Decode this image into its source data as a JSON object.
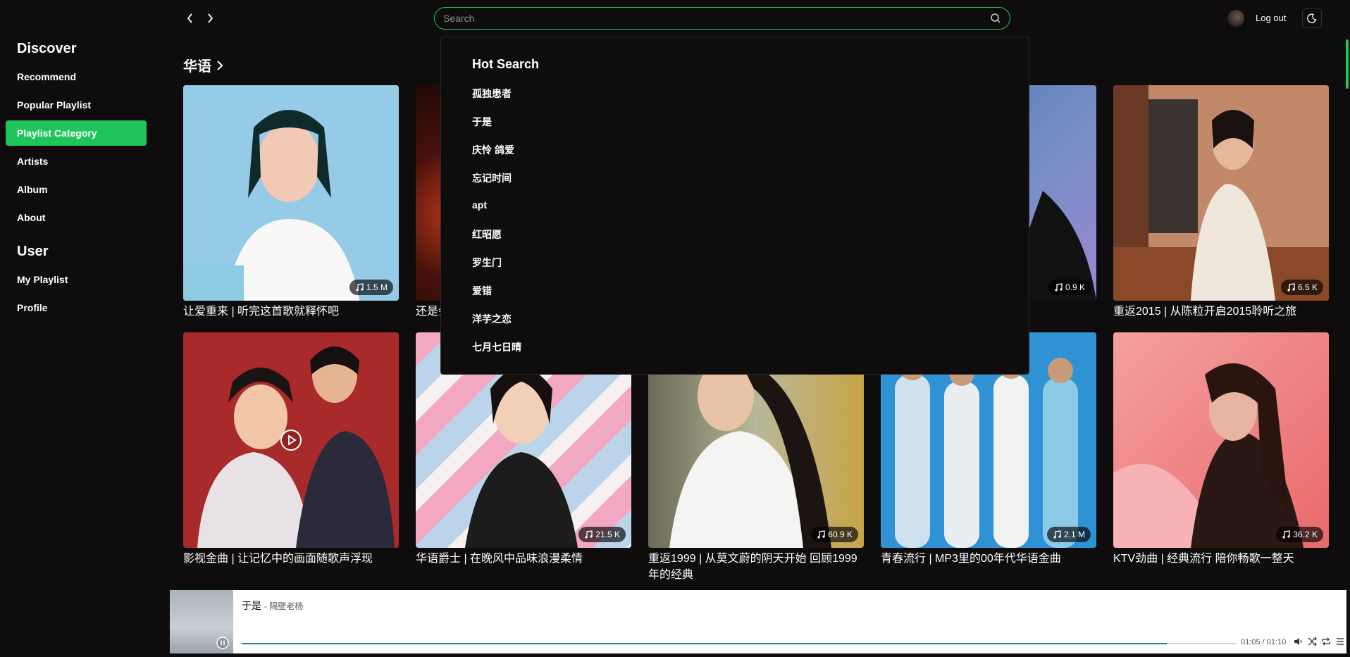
{
  "sidebar": {
    "discover_title": "Discover",
    "discover_items": [
      "Recommend",
      "Popular Playlist",
      "Playlist Category",
      "Artists",
      "Album",
      "About"
    ],
    "user_title": "User",
    "user_items": [
      "My Playlist",
      "Profile"
    ],
    "active_item": "Playlist Category"
  },
  "header": {
    "search_placeholder": "Search",
    "search_value": "",
    "logout_label": "Log out",
    "icons": [
      "chevron-left-icon",
      "chevron-right-icon",
      "search-icon",
      "moon-icon"
    ]
  },
  "category": {
    "title": "华语"
  },
  "hot_search": {
    "title": "Hot Search",
    "items": [
      "孤独患者",
      "于是",
      "庆怜 鸽爱",
      "忘记时间",
      "apt",
      "红昭愿",
      "罗生门",
      "爱错",
      "洋芋之恋",
      "七月七日晴"
    ]
  },
  "playlists": [
    {
      "title": "让爱重来 | 听完这首歌就释怀吧",
      "count": "1.5 M"
    },
    {
      "title": "还是会",
      "count": ""
    },
    {
      "title": "",
      "count": ""
    },
    {
      "title": "",
      "count": "0.9 K"
    },
    {
      "title": "重返2015 | 从陈粒开启2015聆听之旅",
      "count": "6.5 K"
    },
    {
      "title": "影视金曲 | 让记忆中的画面随歌声浮现",
      "count": ""
    },
    {
      "title": "华语爵士 | 在晚风中品味浪漫柔情",
      "count": "21.5 K"
    },
    {
      "title": "重返1999 | 从莫文蔚的阴天开始 回顾1999年的经典",
      "count": "60.9 K"
    },
    {
      "title": "青春流行 | MP3里的00年代华语金曲",
      "count": "2.1 M"
    },
    {
      "title": "KTV劲曲 | 经典流行 陪你畅歌一整天",
      "count": "36.2 K"
    }
  ],
  "player": {
    "song": "于是",
    "artist": "- 隔壁老杨",
    "time": "01:05 / 01:10",
    "progress": 0.93
  },
  "colors": {
    "accent": "#1fc55a",
    "background": "#0e0c0d",
    "progress": "#1b8c4c"
  }
}
